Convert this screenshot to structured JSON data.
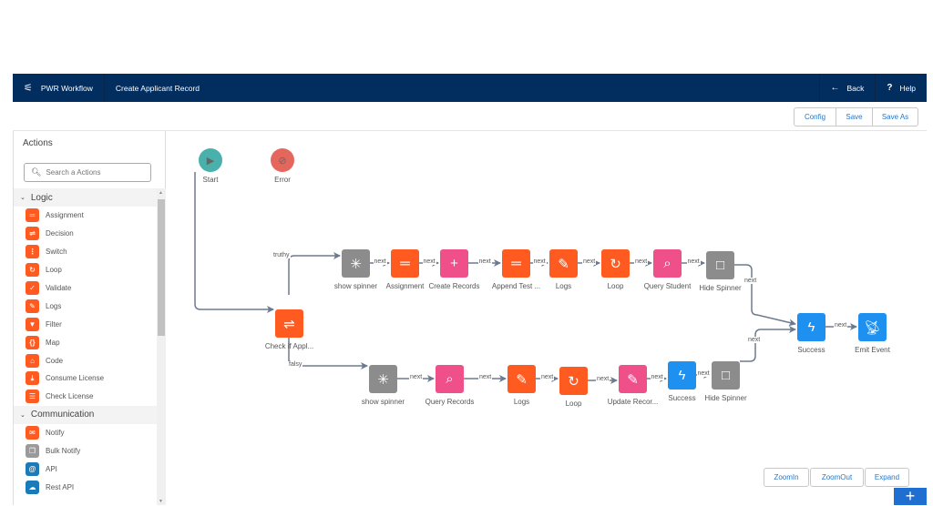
{
  "header": {
    "app_name": "PWR Workflow",
    "workflow_title": "Create Applicant Record",
    "back_label": "Back",
    "help_label": "Help",
    "back_icon": "arrow-left-icon",
    "help_icon": "question-icon",
    "brand_color": "#012d5f"
  },
  "toolbar": {
    "config_label": "Config",
    "save_label": "Save",
    "save_as_label": "Save As"
  },
  "sidebar": {
    "title": "Actions",
    "search_placeholder": "Search a Actions",
    "categories": [
      {
        "name": "Logic",
        "items": [
          {
            "label": "Assignment",
            "icon": "equals-icon",
            "color": "#ff5a1f"
          },
          {
            "label": "Decision",
            "icon": "decision-icon",
            "color": "#ff5a1f"
          },
          {
            "label": "Switch",
            "icon": "switch-icon",
            "color": "#ff5a1f"
          },
          {
            "label": "Loop",
            "icon": "loop-icon",
            "color": "#ff5a1f"
          },
          {
            "label": "Validate",
            "icon": "validate-icon",
            "color": "#ff5a1f"
          },
          {
            "label": "Logs",
            "icon": "logs-icon",
            "color": "#ff5a1f"
          },
          {
            "label": "Filter",
            "icon": "filter-icon",
            "color": "#ff5a1f"
          },
          {
            "label": "Map",
            "icon": "map-icon",
            "color": "#ff5a1f"
          },
          {
            "label": "Code",
            "icon": "code-icon",
            "color": "#ff5a1f"
          },
          {
            "label": "Consume License",
            "icon": "download-icon",
            "color": "#ff5a1f"
          },
          {
            "label": "Check License",
            "icon": "check-license-icon",
            "color": "#ff5a1f"
          }
        ]
      },
      {
        "name": "Communication",
        "items": [
          {
            "label": "Notify",
            "icon": "mail-icon",
            "color": "#ff5a1f"
          },
          {
            "label": "Bulk Notify",
            "icon": "bulk-notify-icon",
            "color": "#9a9a9a"
          },
          {
            "label": "API",
            "icon": "api-icon",
            "color": "#1b7ab8"
          },
          {
            "label": "Rest API",
            "icon": "cloud-api-icon",
            "color": "#1b7ab8"
          }
        ]
      }
    ]
  },
  "canvas": {
    "nodes": {
      "start": {
        "label": "Start",
        "color": "#49b0ab"
      },
      "error": {
        "label": "Error",
        "color": "#e5665c"
      },
      "check": {
        "label": "Check if Appl...",
        "color": "#ff5a1f"
      },
      "t_spinner": {
        "label": "show spinner",
        "color": "#8c8c8c"
      },
      "t_assign": {
        "label": "Assignment",
        "color": "#ff5a1f"
      },
      "t_create": {
        "label": "Create Records",
        "color": "#f0508a"
      },
      "t_append": {
        "label": "Append Test ...",
        "color": "#ff5a1f"
      },
      "t_logs": {
        "label": "Logs",
        "color": "#ff5a1f"
      },
      "t_loop": {
        "label": "Loop",
        "color": "#ff5a1f"
      },
      "t_query": {
        "label": "Query Student",
        "color": "#f0508a"
      },
      "t_hide": {
        "label": "Hide Spinner",
        "color": "#8c8c8c"
      },
      "f_spinner": {
        "label": "show spinner",
        "color": "#8c8c8c"
      },
      "f_query": {
        "label": "Query Records",
        "color": "#f0508a"
      },
      "f_logs": {
        "label": "Logs",
        "color": "#ff5a1f"
      },
      "f_loop": {
        "label": "Loop",
        "color": "#ff5a1f"
      },
      "f_update": {
        "label": "Update Recor...",
        "color": "#f0508a"
      },
      "f_success": {
        "label": "Success",
        "color": "#1e90f0"
      },
      "f_hide": {
        "label": "Hide Spinner",
        "color": "#8c8c8c"
      },
      "success": {
        "label": "Success",
        "color": "#1e90f0"
      },
      "emit": {
        "label": "Emit Event",
        "color": "#1e90f0"
      }
    },
    "edge_labels": {
      "truthy": "truthy",
      "falsy": "falsy",
      "next": "next"
    }
  },
  "zoom_controls": {
    "zoom_in_label": "ZoomIn",
    "zoom_out_label": "ZoomOut",
    "expand_label": "Expand",
    "add_label": "+"
  }
}
